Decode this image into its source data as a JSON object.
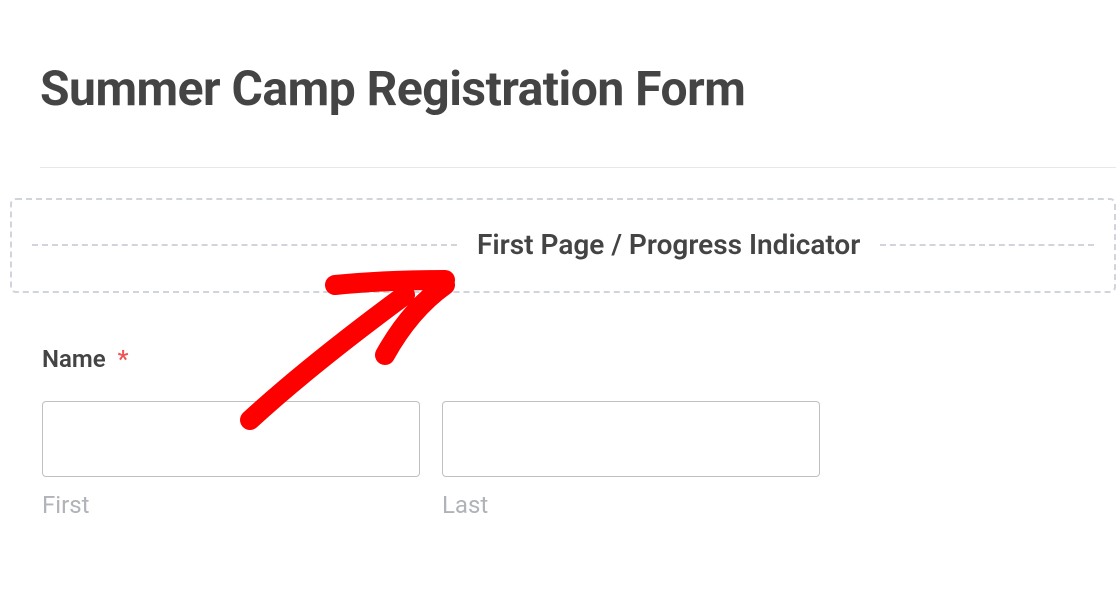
{
  "header": {
    "title": "Summer Camp Registration Form"
  },
  "indicator": {
    "label": "First Page / Progress Indicator"
  },
  "form": {
    "name_label": "Name",
    "required_symbol": "*",
    "first_sub": "First",
    "last_sub": "Last",
    "first_value": "",
    "last_value": ""
  },
  "annotation": {
    "color": "#ff0000",
    "type": "arrow"
  }
}
